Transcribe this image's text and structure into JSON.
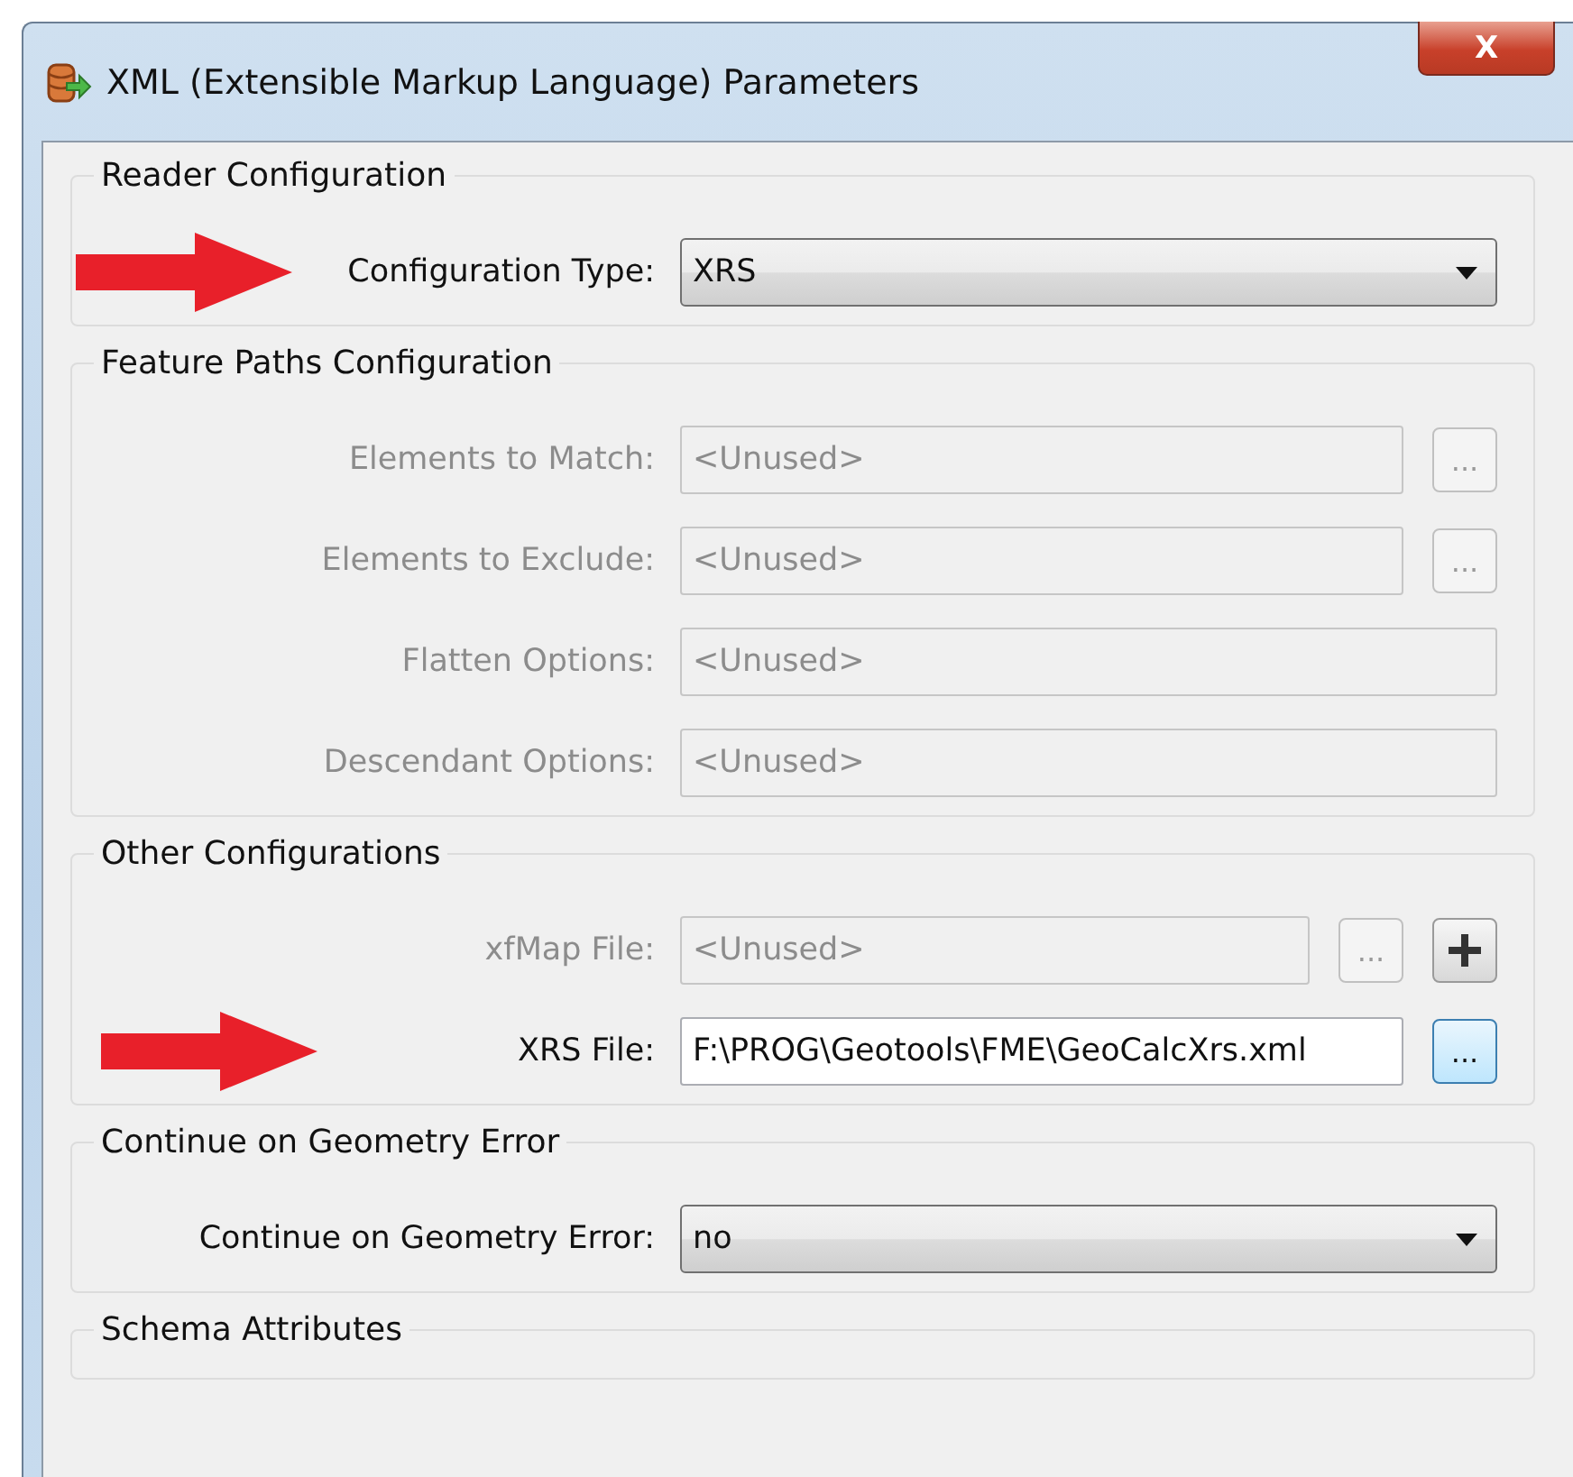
{
  "window": {
    "title": "XML (Extensible Markup Language) Parameters",
    "close_button": "X"
  },
  "groups": [
    {
      "title": "Reader Configuration",
      "rows": [
        {
          "label": "Configuration Type:",
          "kind": "select",
          "value": "XRS",
          "disabled": false,
          "marked": true
        }
      ]
    },
    {
      "title": "Feature Paths Configuration",
      "rows": [
        {
          "label": "Elements to Match:",
          "kind": "text",
          "value": "<Unused>",
          "disabled": true,
          "marked": false,
          "browse": "..."
        },
        {
          "label": "Elements to Exclude:",
          "kind": "text",
          "value": "<Unused>",
          "disabled": true,
          "marked": false,
          "browse": "..."
        },
        {
          "label": "Flatten Options:",
          "kind": "text",
          "value": "<Unused>",
          "disabled": true,
          "marked": false
        },
        {
          "label": "Descendant Options:",
          "kind": "text",
          "value": "<Unused>",
          "disabled": true,
          "marked": false
        }
      ]
    },
    {
      "title": "Other Configurations",
      "rows": [
        {
          "label": "xfMap File:",
          "kind": "text",
          "value": "<Unused>",
          "disabled": true,
          "marked": false,
          "browse": "...",
          "add": true
        },
        {
          "label": "XRS File:",
          "kind": "text",
          "value": "F:\\PROG\\Geotools\\FME\\GeoCalcXrs.xml",
          "disabled": false,
          "marked": true,
          "browse": "..."
        }
      ]
    },
    {
      "title": "Continue on Geometry Error",
      "rows": [
        {
          "label": "Continue on Geometry Error:",
          "kind": "select",
          "value": "no",
          "disabled": false,
          "marked": false
        }
      ]
    },
    {
      "title": "Schema Attributes"
    }
  ]
}
